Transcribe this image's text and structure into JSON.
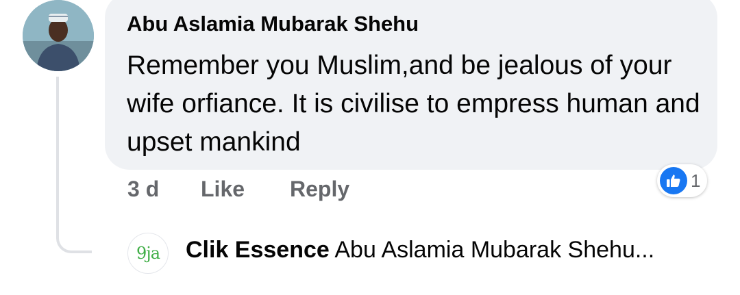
{
  "comment": {
    "author": "Abu Aslamia Mubarak Shehu",
    "text": "Remember you Muslim,and be jealous of your wife orfiance. It is civilise to empress human and upset mankind",
    "time": "3 d",
    "like_label": "Like",
    "reply_label": "Reply",
    "reaction_icon": "thumbs-up-icon",
    "reaction_count": "1"
  },
  "reply_preview": {
    "logo_text": "9ja",
    "author": "Clik Essence",
    "text": "Abu Aslamia Mubarak Shehu..."
  },
  "colors": {
    "bubble": "#f0f2f5",
    "like_blue": "#1877f2",
    "meta_gray": "#65676b",
    "thread_line": "#dfe1e5",
    "logo_green": "#3fae46"
  }
}
